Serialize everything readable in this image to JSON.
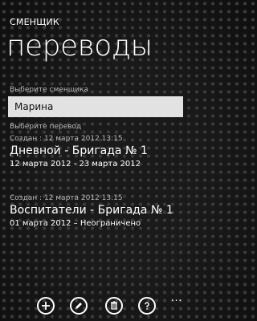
{
  "header": {
    "app_title": "СМЕНЩИК",
    "page_title": "переводы"
  },
  "shift_picker": {
    "label": "Выберите сменщика",
    "value": "Марина"
  },
  "transfers": {
    "label": "Выберите перевод",
    "items": [
      {
        "created": "Создан : 12 марта 2012 13:15",
        "name": "Дневной - Бригада № 1",
        "dates": "12 марта 2012 - 23 марта 2012"
      },
      {
        "created": "Создан : 12 марта 2012 13:15",
        "name": "Воспитатели - Бригада № 1",
        "dates": "01 марта 2012 – Неограничено"
      }
    ]
  },
  "app_bar": {
    "buttons": [
      "add-icon",
      "edit-icon",
      "delete-icon",
      "help-icon"
    ],
    "more": "..."
  }
}
